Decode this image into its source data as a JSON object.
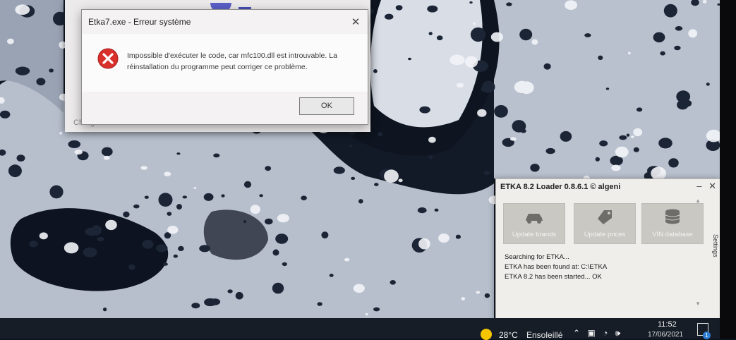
{
  "teams_splash": {
    "status": "Chargement de Microsoft Teams ..."
  },
  "error_dialog": {
    "title": "Etka7.exe - Erreur système",
    "close": "✕",
    "message": "Impossible d'exécuter le code, car mfc100.dll est introuvable. La réinstallation du programme peut corriger ce problème.",
    "ok_label": "OK"
  },
  "loader": {
    "title": "ETKA 8.2 Loader 0.8.6.1 © algeni",
    "minimize": "–",
    "close": "✕",
    "buttons": [
      {
        "label": "Update brands",
        "icon": "car-icon"
      },
      {
        "label": "Update prices",
        "icon": "price-tag-icon"
      },
      {
        "label": "VIN database",
        "icon": "database-icon"
      }
    ],
    "log": [
      "Searching for ETKA...",
      "ETKA has been found at: C:\\ETKA",
      "ETKA 8.2 has been started... OK"
    ],
    "settings_label": "Settings"
  },
  "taskbar": {
    "temperature": "28°C",
    "condition": "Ensoleillé",
    "tray_icons": [
      "chevron-up-icon",
      "network-icon",
      "wifi-icon",
      "volume-icon"
    ],
    "time": "11:52",
    "date": "17/06/2021",
    "notification_count": "1"
  },
  "colors": {
    "taskbar": "#161d27",
    "error_red": "#d9302c",
    "teams_purple": "#5b5fc7"
  }
}
